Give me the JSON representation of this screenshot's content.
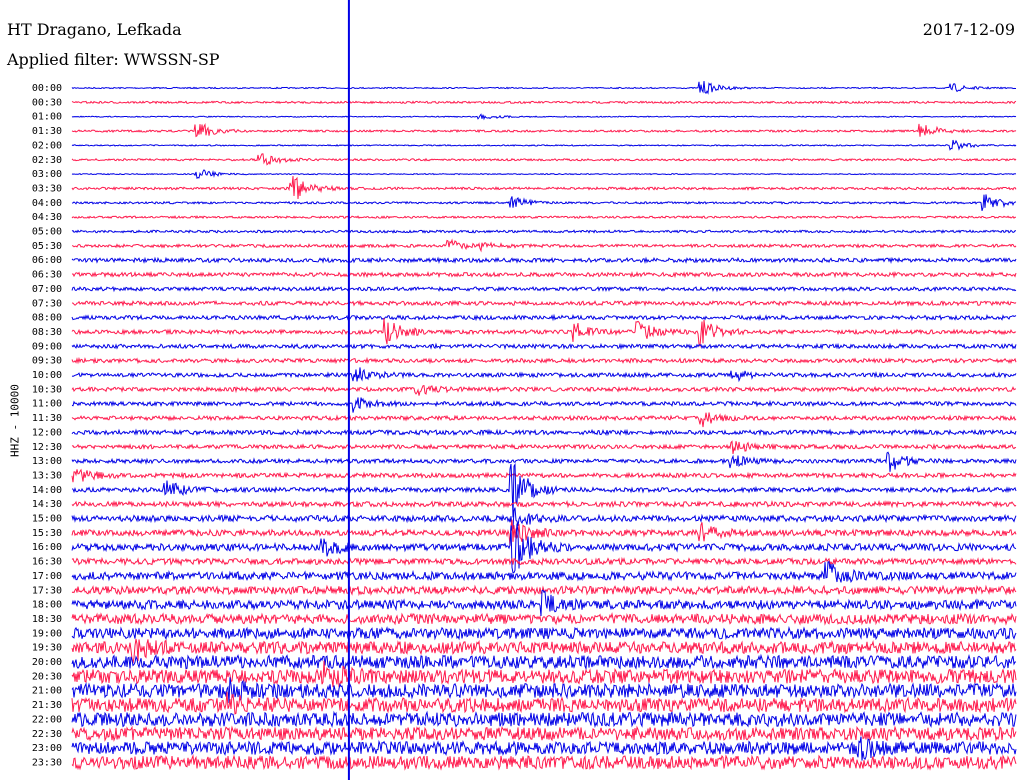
{
  "header": {
    "station": "HT Dragano, Lefkada",
    "date": "2017-12-09",
    "filter_text": "Applied filter: WWSSN-SP"
  },
  "colors": {
    "odd": "#0000e6",
    "even": "#ff1a4d",
    "marker": "#0000e6"
  },
  "chart_data": {
    "type": "line",
    "title": "HT Dragano, Lefkada",
    "subtitle": "Applied filter: WWSSN-SP",
    "ylabel": "HHZ - 10000",
    "xlabel": "",
    "tick_labels": [
      "00:00",
      "00:30",
      "01:00",
      "01:30",
      "02:00",
      "02:30",
      "03:00",
      "03:30",
      "04:00",
      "04:30",
      "05:00",
      "05:30",
      "06:00",
      "06:30",
      "07:00",
      "07:30",
      "08:00",
      "08:30",
      "09:00",
      "09:30",
      "10:00",
      "10:30",
      "11:00",
      "11:30",
      "12:00",
      "12:30",
      "13:00",
      "13:30",
      "14:00",
      "14:30",
      "15:00",
      "15:30",
      "16:00",
      "16:30",
      "17:00",
      "17:30",
      "18:00",
      "18:30",
      "19:00",
      "19:30",
      "20:00",
      "20:30",
      "21:00",
      "21:30",
      "22:00",
      "22:30",
      "23:00",
      "23:30"
    ],
    "noise_level": [
      0.6,
      1,
      0.5,
      1,
      0.6,
      1,
      0.5,
      1.2,
      1,
      1,
      1.2,
      1.5,
      2,
      2,
      1.8,
      2,
      2,
      2,
      2,
      2,
      2,
      2,
      2,
      2,
      2.2,
      2,
      2,
      2.2,
      2.2,
      2.5,
      3,
      3,
      3.5,
      3,
      4,
      4,
      4.5,
      5,
      5.5,
      6,
      6.5,
      7,
      7,
      7,
      7,
      6.5,
      6.5,
      6.5
    ],
    "events": [
      {
        "row": 0,
        "minute": 20,
        "amp": 8
      },
      {
        "row": 0,
        "minute": 28,
        "amp": 4
      },
      {
        "row": 2,
        "minute": 13,
        "amp": 3
      },
      {
        "row": 3,
        "minute": 4,
        "amp": 9
      },
      {
        "row": 3,
        "minute": 27,
        "amp": 8
      },
      {
        "row": 4,
        "minute": 28,
        "amp": 5
      },
      {
        "row": 5,
        "minute": 6,
        "amp": 7
      },
      {
        "row": 6,
        "minute": 4,
        "amp": 6
      },
      {
        "row": 7,
        "minute": 7,
        "amp": 14
      },
      {
        "row": 8,
        "minute": 14,
        "amp": 7
      },
      {
        "row": 8,
        "minute": 29,
        "amp": 10
      },
      {
        "row": 11,
        "minute": 12,
        "amp": 5
      },
      {
        "row": 11,
        "minute": 13,
        "amp": 3
      },
      {
        "row": 17,
        "minute": 10,
        "amp": 12
      },
      {
        "row": 17,
        "minute": 16,
        "amp": 9
      },
      {
        "row": 17,
        "minute": 18,
        "amp": 10
      },
      {
        "row": 17,
        "minute": 20,
        "amp": 13
      },
      {
        "row": 20,
        "minute": 9,
        "amp": 8
      },
      {
        "row": 20,
        "minute": 21,
        "amp": 6
      },
      {
        "row": 21,
        "minute": 11,
        "amp": 5
      },
      {
        "row": 22,
        "minute": 9,
        "amp": 7
      },
      {
        "row": 23,
        "minute": 20,
        "amp": 8
      },
      {
        "row": 25,
        "minute": 21,
        "amp": 6
      },
      {
        "row": 26,
        "minute": 26,
        "amp": 10
      },
      {
        "row": 26,
        "minute": 21,
        "amp": 6
      },
      {
        "row": 27,
        "minute": 0,
        "amp": 10
      },
      {
        "row": 28,
        "minute": 3,
        "amp": 9
      },
      {
        "row": 28,
        "minute": 14,
        "amp": 30
      },
      {
        "row": 30,
        "minute": 14,
        "amp": 10
      },
      {
        "row": 31,
        "minute": 14,
        "amp": 12
      },
      {
        "row": 31,
        "minute": 20,
        "amp": 8
      },
      {
        "row": 32,
        "minute": 8,
        "amp": 8
      },
      {
        "row": 32,
        "minute": 14,
        "amp": 30
      },
      {
        "row": 34,
        "minute": 24,
        "amp": 12
      },
      {
        "row": 36,
        "minute": 15,
        "amp": 10
      },
      {
        "row": 39,
        "minute": 2,
        "amp": 10
      },
      {
        "row": 41,
        "minute": 8,
        "amp": 12
      },
      {
        "row": 42,
        "minute": 5,
        "amp": 9
      },
      {
        "row": 43,
        "minute": 5,
        "amp": 9
      },
      {
        "row": 46,
        "minute": 25,
        "amp": 10
      }
    ],
    "minutes_per_line": 30,
    "marker_minute": 8.8,
    "grid": false
  }
}
